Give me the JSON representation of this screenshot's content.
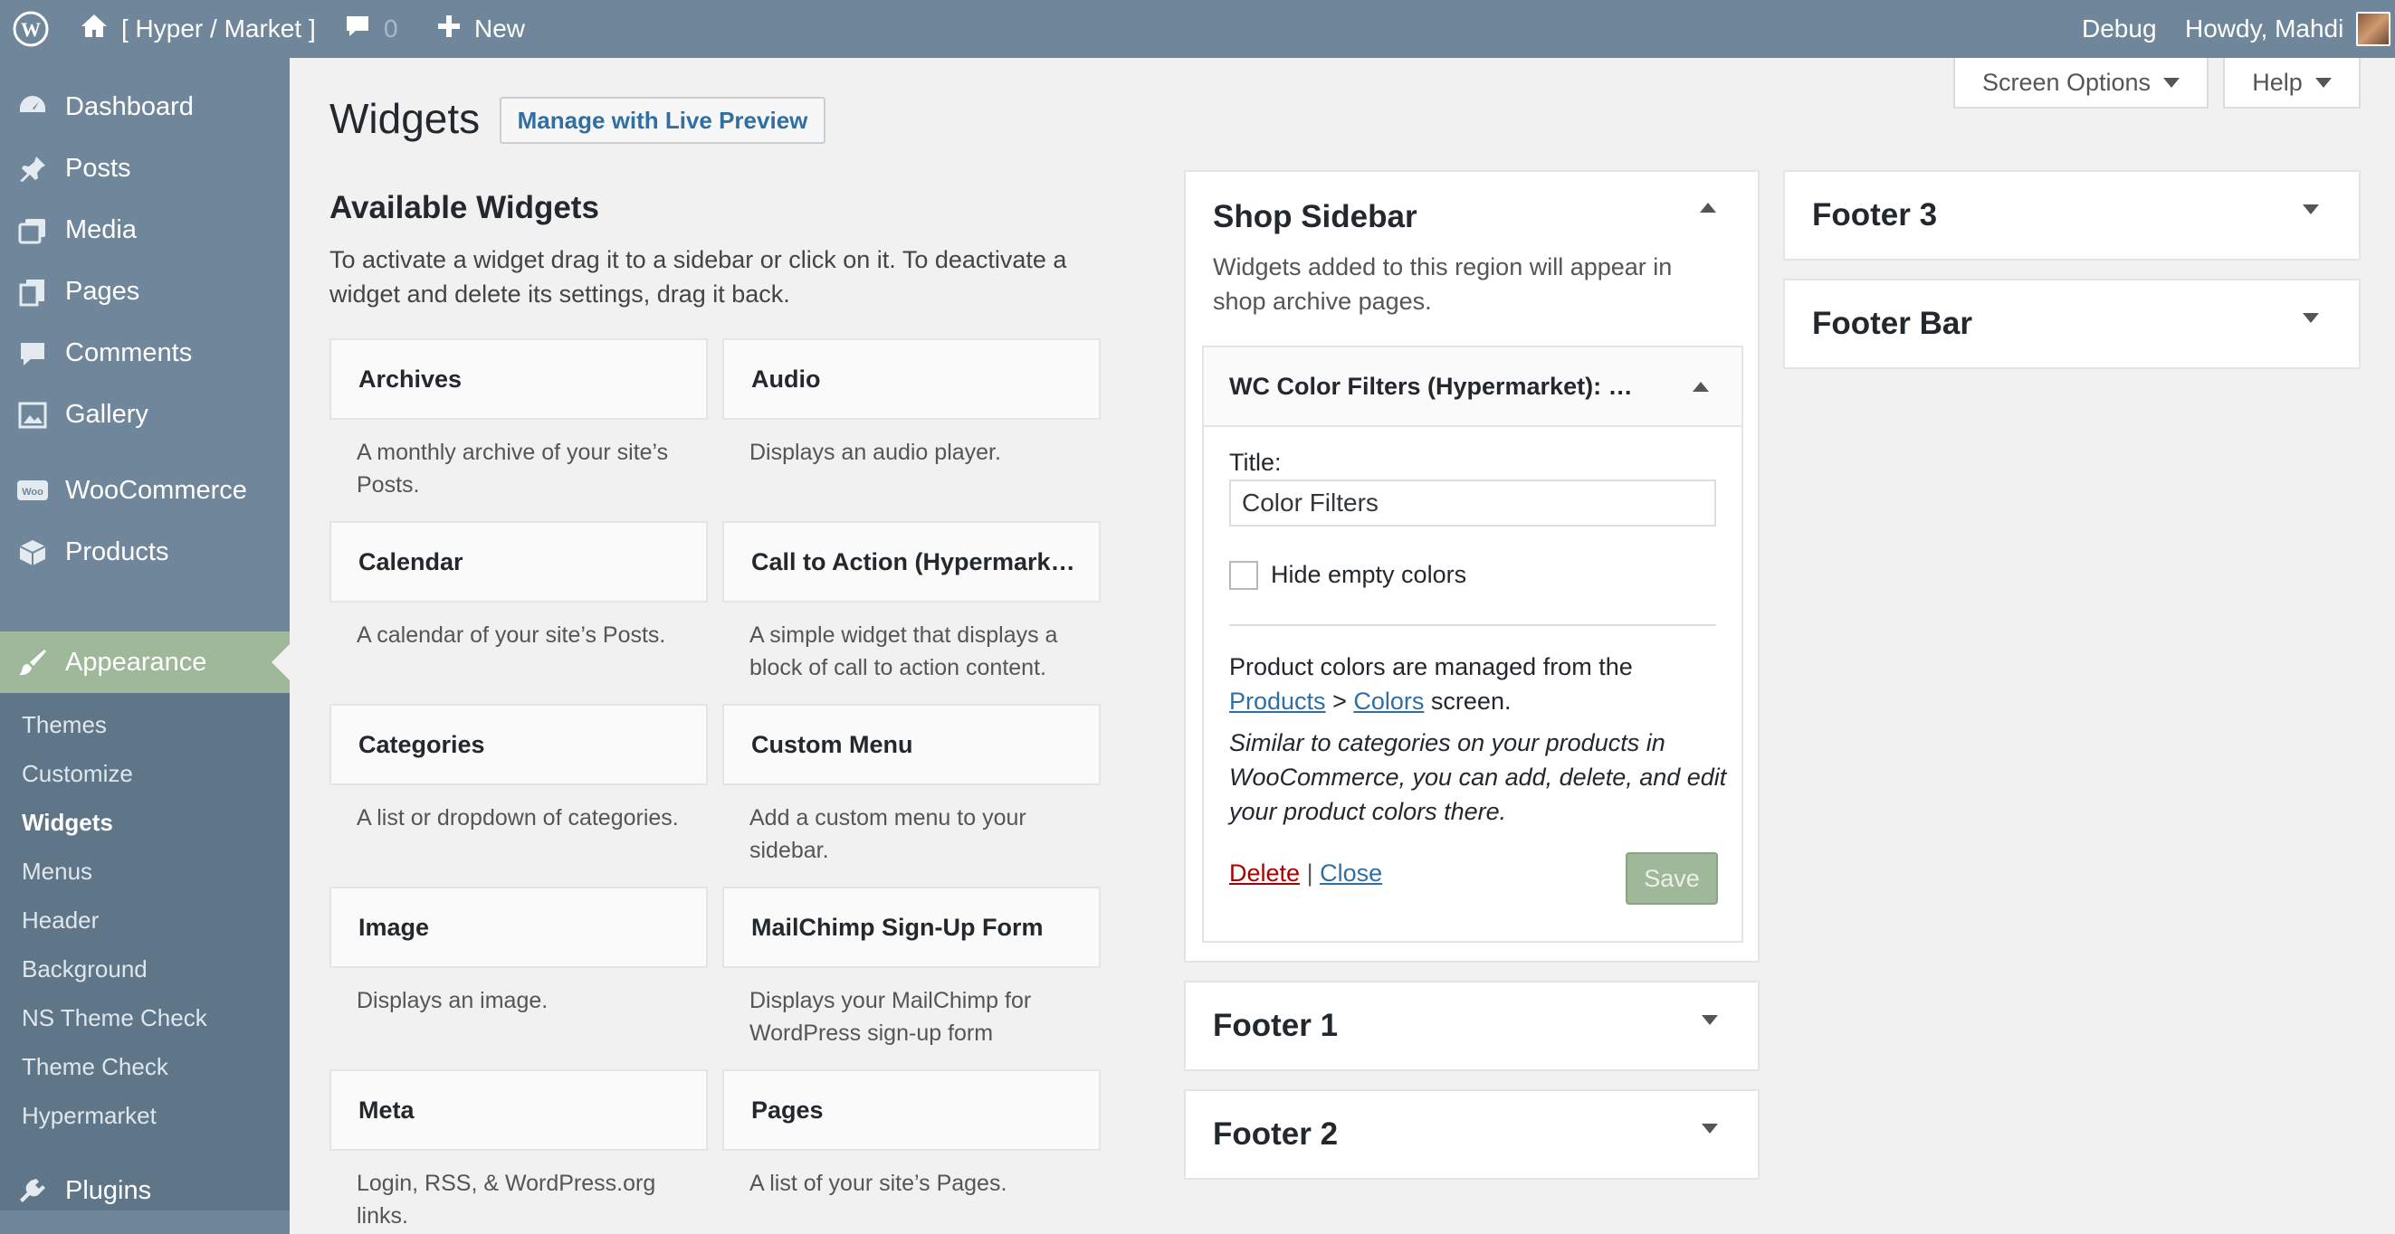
{
  "adminbar": {
    "site_name": "[ Hyper / Market ]",
    "comments_count": "0",
    "new_label": "New",
    "debug_label": "Debug",
    "howdy": "Howdy, Mahdi"
  },
  "menu": {
    "dashboard": "Dashboard",
    "posts": "Posts",
    "media": "Media",
    "pages": "Pages",
    "comments": "Comments",
    "gallery": "Gallery",
    "woocommerce": "WooCommerce",
    "products": "Products",
    "appearance": "Appearance",
    "plugins": "Plugins",
    "submenu": [
      "Themes",
      "Customize",
      "Widgets",
      "Menus",
      "Header",
      "Background",
      "NS Theme Check",
      "Theme Check",
      "Hypermarket"
    ]
  },
  "header": {
    "title": "Widgets",
    "live_preview": "Manage with Live Preview",
    "screen_options": "Screen Options",
    "help": "Help"
  },
  "available": {
    "title": "Available Widgets",
    "description": "To activate a widget drag it to a sidebar or click on it. To deactivate a widget and delete its settings, drag it back.",
    "widgets": [
      {
        "name": "Archives",
        "desc": "A monthly archive of your site’s Posts."
      },
      {
        "name": "Audio",
        "desc": "Displays an audio player."
      },
      {
        "name": "Calendar",
        "desc": "A calendar of your site’s Posts."
      },
      {
        "name": "Call to Action (Hypermark…",
        "desc": "A simple widget that displays a block of call to action content."
      },
      {
        "name": "Categories",
        "desc": "A list or dropdown of categories."
      },
      {
        "name": "Custom Menu",
        "desc": "Add a custom menu to your sidebar."
      },
      {
        "name": "Image",
        "desc": "Displays an image."
      },
      {
        "name": "MailChimp Sign-Up Form",
        "desc": "Displays your MailChimp for WordPress sign-up form"
      },
      {
        "name": "Meta",
        "desc": "Login, RSS, & WordPress.org links."
      },
      {
        "name": "Pages",
        "desc": "A list of your site’s Pages."
      }
    ]
  },
  "shop_sidebar": {
    "title": "Shop Sidebar",
    "description": "Widgets added to this region will appear in shop archive pages.",
    "widget": {
      "title": "WC Color Filters (Hypermarket): …",
      "title_label": "Title:",
      "title_value": "Color Filters",
      "checkbox_label": "Hide empty colors",
      "info_prefix": "Product colors are managed from the",
      "products_link": "Products",
      "separator": ">",
      "colors_link": "Colors",
      "info_suffix": "screen.",
      "note": "Similar to categories on your products in WooCommerce, you can add, delete, and edit your product colors there.",
      "delete": "Delete",
      "pipe": "|",
      "close": "Close",
      "save": "Save"
    }
  },
  "sidebars": {
    "footer1": "Footer 1",
    "footer2": "Footer 2",
    "footer3": "Footer 3",
    "footerbar": "Footer Bar"
  }
}
